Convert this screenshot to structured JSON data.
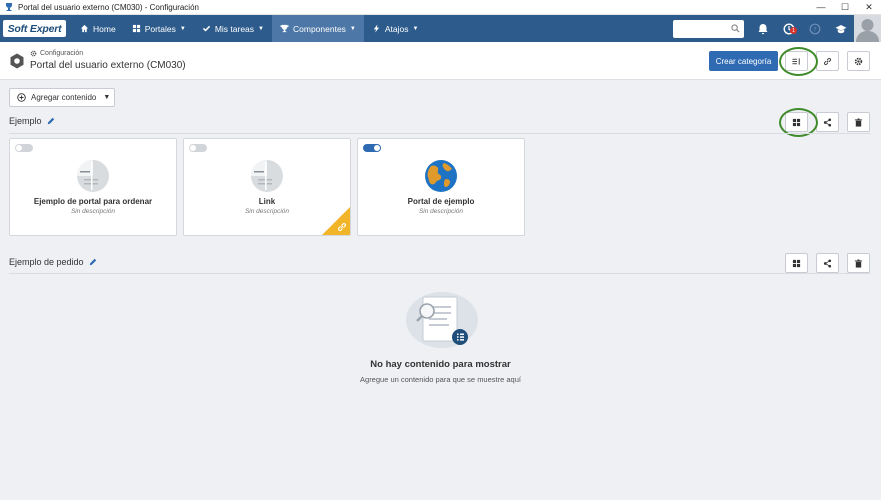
{
  "window": {
    "title": "Portal del usuario externo (CM030) - Configuración"
  },
  "navbar": {
    "logo": "Soft Expert",
    "items": [
      {
        "label": "Home",
        "icon": "home-icon"
      },
      {
        "label": "Portales",
        "icon": "grid-icon"
      },
      {
        "label": "Mis tareas",
        "icon": "check-icon"
      },
      {
        "label": "Componentes",
        "icon": "trophy-icon",
        "active": true
      },
      {
        "label": "Atajos",
        "icon": "bolt-icon"
      }
    ],
    "badge_count": "1"
  },
  "header": {
    "breadcrumb": "Configuración",
    "title": "Portal del usuario externo (CM030)",
    "create_label": "Crear categoría"
  },
  "toolbar": {
    "add_content_label": "Agregar contenido"
  },
  "sections": [
    {
      "title": "Ejemplo",
      "cards": [
        {
          "title": "Ejemplo de portal para ordenar",
          "desc": "Sin descripción",
          "enabled": false,
          "image": "pie-chart-icon"
        },
        {
          "title": "Link",
          "desc": "Sin descripción",
          "enabled": false,
          "image": "pie-chart-icon",
          "link_corner": true
        },
        {
          "title": "Portal de ejemplo",
          "desc": "Sin descripción",
          "enabled": true,
          "image": "globe-icon"
        }
      ]
    },
    {
      "title": "Ejemplo de pedido",
      "empty": {
        "title": "No hay contenido para mostrar",
        "subtitle": "Agregue un contenido para que se muestre aquí"
      }
    }
  ],
  "colors": {
    "navbar": "#2c5b8c",
    "active_nav": "#4d77a6",
    "primary": "#2e6bb3",
    "highlight_ring": "#3f8a2b",
    "link_corner": "#f2b52a"
  }
}
